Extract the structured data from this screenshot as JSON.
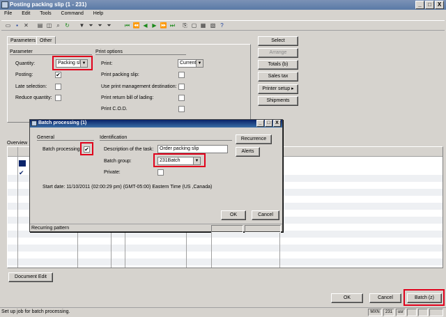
{
  "window": {
    "title": "Posting packing slip (1 - 231)",
    "minimize": "_",
    "maximize": "□",
    "close": "X"
  },
  "menu": [
    "File",
    "Edit",
    "Tools",
    "Command",
    "Help"
  ],
  "tabs": [
    "Parameters",
    "Other"
  ],
  "parameters": {
    "group_label": "Parameter",
    "quantity_label": "Quantity:",
    "quantity_value": "Packing slip",
    "posting_label": "Posting:",
    "posting_checked": true,
    "late_selection_label": "Late selection:",
    "reduce_quantity_label": "Reduce quantity:"
  },
  "print_options": {
    "group_label": "Print options",
    "print_label": "Print:",
    "print_value": "Current",
    "print_packing_slip_label": "Print packing slip:",
    "use_print_mgmt_label": "Use print management destination:",
    "print_return_bill_label": "Print return bill of lading:",
    "print_cod_label": "Print C.O.D."
  },
  "side_buttons": {
    "select": "Select",
    "arrange": "Arrange",
    "totals": "Totals (b)",
    "sales_tax": "Sales tax",
    "printer_setup": "Printer setup",
    "shipments": "Shipments"
  },
  "overview": {
    "label": "Overview",
    "row_check": "✔"
  },
  "dialog": {
    "title": "Batch processing (1)",
    "general_label": "General",
    "batch_processing_label": "Batch processing:",
    "batch_processing_checked": true,
    "identification_label": "Identification",
    "description_label": "Description of the task:",
    "description_value": "Order packing slip",
    "batch_group_label": "Batch group:",
    "batch_group_value": "231Batch",
    "private_label": "Private:",
    "recurrence_button": "Recurrence",
    "alerts_button": "Alerts",
    "start_date_text": "Start date: 11/10/2011 (02:00:29 pm) (GMT-05:00) Eastern Time (US ,Canada)",
    "ok_button": "OK",
    "cancel_button": "Cancel",
    "recurring_pattern": "Recurring pattern"
  },
  "bottom": {
    "document_edit": "Document Edit",
    "ok": "OK",
    "cancel": "Cancel",
    "batch": "Batch (z)"
  },
  "status": {
    "message": "Set up job for batch processing.",
    "cells": [
      "MXN",
      "231",
      "usr",
      "",
      "",
      ""
    ]
  },
  "colors": {
    "highlight": "#e0001b",
    "title_bar": "#5a7aa6",
    "dialog_title": "#0a246a"
  }
}
